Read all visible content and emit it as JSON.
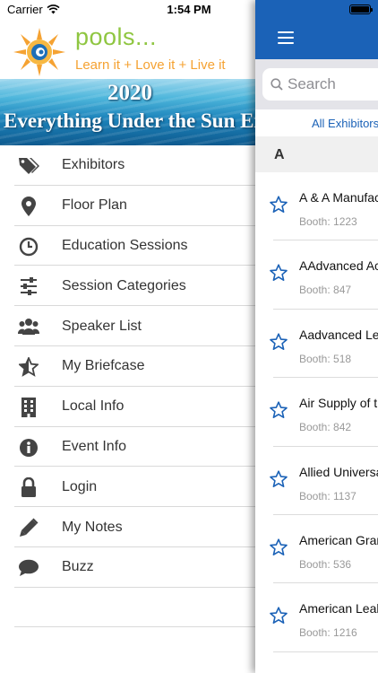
{
  "status_bar": {
    "carrier": "Carrier",
    "time": "1:54 PM",
    "battery_level": 1.0
  },
  "logo": {
    "word": "pools...",
    "tagline": "Learn it + Love it + Live it"
  },
  "banner": {
    "year": "2020",
    "title": "Everything Under the Sun Expo"
  },
  "menu": {
    "items": [
      {
        "label": "Exhibitors",
        "icon": "tags-icon"
      },
      {
        "label": "Floor Plan",
        "icon": "map-pin-icon"
      },
      {
        "label": "Education Sessions",
        "icon": "clock-icon"
      },
      {
        "label": "Session Categories",
        "icon": "sliders-icon"
      },
      {
        "label": "Speaker List",
        "icon": "users-icon"
      },
      {
        "label": "My Briefcase",
        "icon": "half-star-icon"
      },
      {
        "label": "Local Info",
        "icon": "building-icon"
      },
      {
        "label": "Event Info",
        "icon": "info-circle-icon"
      },
      {
        "label": "Login",
        "icon": "lock-icon"
      },
      {
        "label": "My Notes",
        "icon": "pencil-icon"
      },
      {
        "label": "Buzz",
        "icon": "chat-bubble-icon"
      }
    ]
  },
  "panel": {
    "menu_icon": "hamburger-icon",
    "search": {
      "placeholder": "Search"
    },
    "filter_label": "All Exhibitors",
    "section_letter": "A",
    "exhibitors": [
      {
        "name": "A & A Manufacturing",
        "booth": "Booth: 1223"
      },
      {
        "name": "AAdvanced Access",
        "booth": "Booth: 847"
      },
      {
        "name": "Aadvanced Leak",
        "booth": "Booth: 518"
      },
      {
        "name": "Air Supply of the",
        "booth": "Booth: 842"
      },
      {
        "name": "Allied Universal",
        "booth": "Booth: 1137"
      },
      {
        "name": "American Granby",
        "booth": "Booth: 536"
      },
      {
        "name": "American Leak",
        "booth": "Booth: 1216"
      }
    ]
  },
  "colors": {
    "brand_blue": "#1b62b7",
    "logo_green": "#8fc641",
    "logo_orange": "#f5a232",
    "star_blue": "#1b62b7"
  }
}
